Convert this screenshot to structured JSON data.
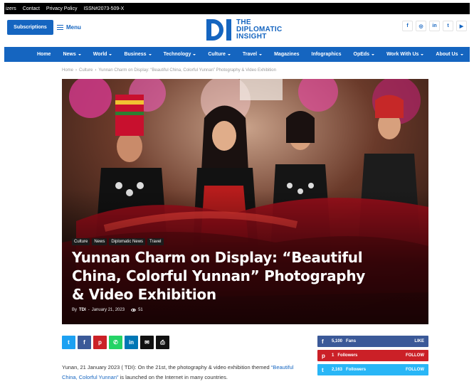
{
  "topbar": {
    "links": [
      "izers",
      "Contact",
      "Privacy Policy",
      "ISSN#2073-509-X"
    ]
  },
  "header": {
    "subscriptions_label": "Subscriptions",
    "menu_label": "Menu",
    "logo_lines": [
      "THE",
      "DIPLOMATIC",
      "INSIGHT"
    ],
    "social_icons": [
      {
        "name": "facebook-icon",
        "glyph": "f"
      },
      {
        "name": "instagram-icon",
        "glyph": "◎"
      },
      {
        "name": "linkedin-icon",
        "glyph": "in"
      },
      {
        "name": "twitter-icon",
        "glyph": "t"
      },
      {
        "name": "youtube-icon",
        "glyph": "▶"
      }
    ]
  },
  "nav": {
    "items": [
      {
        "label": "Home",
        "dropdown": false
      },
      {
        "label": "News",
        "dropdown": true
      },
      {
        "label": "World",
        "dropdown": true
      },
      {
        "label": "Business",
        "dropdown": true
      },
      {
        "label": "Technology",
        "dropdown": true
      },
      {
        "label": "Culture",
        "dropdown": true
      },
      {
        "label": "Travel",
        "dropdown": true
      },
      {
        "label": "Magazines",
        "dropdown": false
      },
      {
        "label": "Infographics",
        "dropdown": false
      },
      {
        "label": "OpEds",
        "dropdown": true
      },
      {
        "label": "Work With Us",
        "dropdown": true
      },
      {
        "label": "About Us",
        "dropdown": true
      }
    ]
  },
  "breadcrumb": [
    "Home",
    "›",
    "Culture",
    "›",
    "Yunnan Charm on Display: “Beautiful China, Colorful Yunnan” Photography & Video Exhibition"
  ],
  "hero": {
    "tags": [
      "Culture",
      "News",
      "Diplomatic News",
      "Travel"
    ],
    "title": "Yunnan Charm on Display: “Beautiful China, Colorful Yunnan” Photography & Video Exhibition",
    "by_label": "By",
    "author": "TDI",
    "separator": "-",
    "date": "January 21, 2023",
    "views": "51"
  },
  "share_buttons": [
    {
      "name": "share-twitter-button",
      "glyph": "t",
      "color": "#1da1f2"
    },
    {
      "name": "share-facebook-button",
      "glyph": "f",
      "color": "#3b5998"
    },
    {
      "name": "share-pinterest-button",
      "glyph": "p",
      "color": "#cb2027"
    },
    {
      "name": "share-whatsapp-button",
      "glyph": "✆",
      "color": "#25d366"
    },
    {
      "name": "share-linkedin-button",
      "glyph": "in",
      "color": "#0077b5"
    },
    {
      "name": "share-email-button",
      "glyph": "✉",
      "color": "#111111"
    },
    {
      "name": "share-print-button",
      "glyph": "⎙",
      "color": "#111111"
    }
  ],
  "article": {
    "text_before": "Yunan, 21 January 2023 ( TDI): On the 21st, the photography & video exhibition themed ",
    "highlight": "“Beautiful China, Colorful Yunnan”",
    "text_after": " is launched on the Internet in many countries."
  },
  "counters": [
    {
      "name": "facebook-counter",
      "glyph": "f",
      "count": "5,100",
      "unit": "Fans",
      "action": "LIKE",
      "color": "#3b5998"
    },
    {
      "name": "pinterest-counter",
      "glyph": "p",
      "count": "1",
      "unit": "Followers",
      "action": "FOLLOW",
      "color": "#cb2027"
    },
    {
      "name": "twitter-counter",
      "glyph": "t",
      "count": "2,163",
      "unit": "Followers",
      "action": "FOLLOW",
      "color": "#29b6f6"
    }
  ],
  "colors": {
    "brand_blue": "#1565c0",
    "topbar": "#000000"
  }
}
